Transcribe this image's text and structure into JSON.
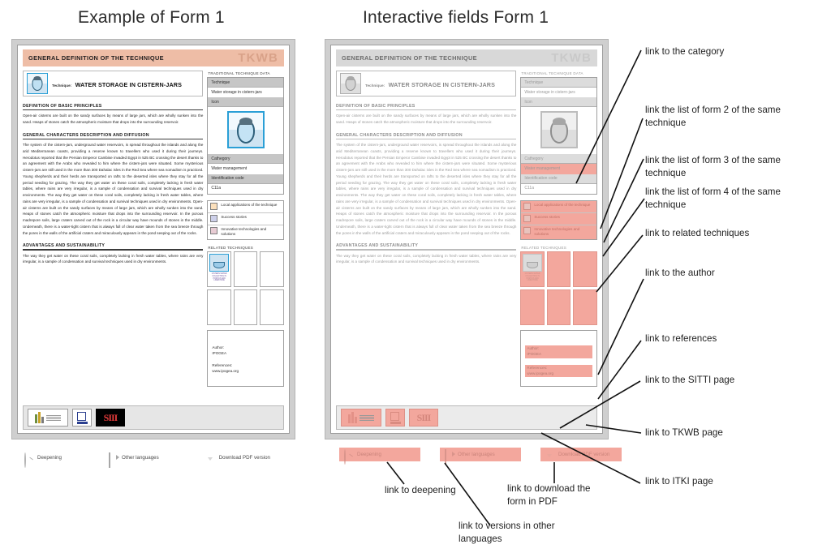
{
  "titles": {
    "left": "Example of Form 1",
    "right": "Interactive fields Form 1"
  },
  "form": {
    "masthead_title": "GENERAL DEFINITION OF THE TECHNIQUE",
    "masthead_logo": "TKWB",
    "technique_label": "Technique:",
    "technique_value": "WATER STORAGE IN CISTERN-JARS",
    "sections": [
      {
        "heading": "DEFINITION OF BASIC PRINCIPLES",
        "text": "Open-air cisterns are built on the sandy surfaces by means of large jars, which are wholly sunken into the sand. Heaps of stones catch the atmospheric moisture that drops into the surrounding reservoir."
      },
      {
        "heading": "GENERAL CHARACTERS DESCRIPTION AND DIFFUSION",
        "text": "The system of the cistern-jars, underground water reservoirs, is spread throughout the islands and along the arid Mediterranean coasts, providing a reserve known to travellers who used it during their journeys. Herodotus reported that the Persian Emperor Cambise invaded Egypt in 525 BC crossing the desert thanks to an agreement with the Arabs who revealed to him where the cistern-jars were situated. Some mysterious cistern-jars are still used in the more than 300 Dahalac isles in the Red Sea where sea nomadism is practiced. Young shepherds and their herds are transported on rafts to the deserted isles where they stay for all the period needing for grazing. The way they get water on these coral soils, completely lacking in fresh water tables, where rains are very irregular, is a sample of condensation and survival techniques used in dry environments. The way they get water on these coral soils, completely lacking in fresh water tables, where rains are very irregular, is a sample of condensation and survival techniques used in dry environments. Open-air cisterns are built on the sandy surfaces by means of large jars, which are wholly sunken into the sand. Heaps of stones catch the atmospheric moisture that drops into the surrounding reservoir. In the porous madrepore soils, large craters carved out of the rock in a circular way have mounds of stones in the middle. Underneath, there is a water-tight cistern that is always full of clear water taken from the sea breeze through the pores in the walls of the artificial craters and miraculously appears in the pond seeping out of the rocks."
      },
      {
        "heading": "ADVANTAGES AND SUSTAINABILITY",
        "text": "The way they get water on these coral soils, completely lacking in fresh water tables, where rains are very irregular, is a sample of condensation and survival techniques used in dry environments."
      }
    ],
    "sidebar": {
      "heading": "TRADITIONAL TECHNIQUE DATA",
      "fields": [
        {
          "label": "Technique",
          "value": "Water storage in cistern-jars"
        },
        {
          "label": "Icon",
          "value": ""
        },
        {
          "label": "Cathegory",
          "value": "Water management"
        },
        {
          "label": "Identification code",
          "value": "C11a"
        }
      ],
      "legend": [
        "Local applications of the technique",
        "Success stories",
        "Innovative technologies and solutions"
      ],
      "related_heading": "RELATED TECHNIQUES",
      "related_thumb_caption": "CISTERN WATER COLLECTING IN POROUS AND LIMESTONE",
      "author_label": "Author:",
      "author_value": "IPOGEA",
      "references_label": "References:",
      "references_value": "www.ipogea.org"
    },
    "logos": {
      "itki": "ITKI",
      "sitti": "SITTI",
      "tkwb": "TKWB"
    }
  },
  "toolbar": [
    {
      "icon": "magnifier-icon",
      "label": "Deepening"
    },
    {
      "icon": "languages-icon",
      "label": "Other languages"
    },
    {
      "icon": "download-icon",
      "label": "Download PDF version"
    }
  ],
  "annotations": {
    "right": [
      "link to the category",
      "link the list of form 2 of the same technique",
      " link the list of form 3 of the same technique",
      "link the list of form 4 of the same technique",
      "link to related techniques",
      "link to the author",
      "link to references",
      "link to the SITTI page",
      "link to TKWB page",
      "link to ITKI page"
    ],
    "bottom": [
      "link to deepening",
      "link to versions in other languages",
      "link to download the form in PDF"
    ]
  },
  "colors": {
    "masthead": "#eebda6",
    "highlight": "#f3a79d",
    "frame": "#cfcfcf"
  }
}
